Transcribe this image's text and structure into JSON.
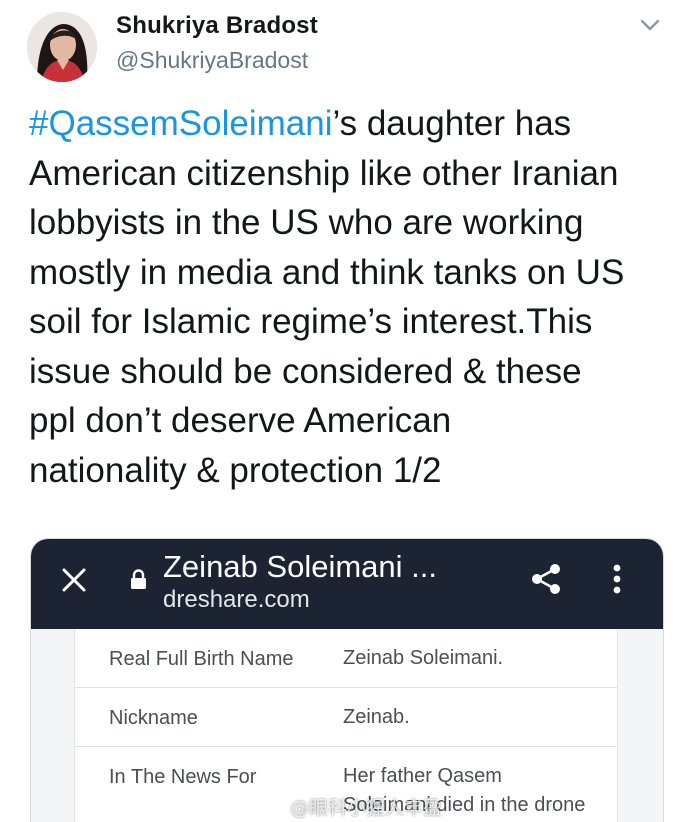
{
  "user": {
    "display_name": "Shukriya Bradost",
    "handle": "@ShukriyaBradost"
  },
  "tweet": {
    "hashtag": "#QassemSoleimani",
    "line1_rest": "’s daughter has",
    "lines": [
      "American citizenship like other Iranian",
      "lobbyists in the US who are working",
      "mostly in media and think tanks on US",
      "soil for Islamic regime’s interest.This",
      "issue should be considered & these",
      "ppl don’t deserve American",
      "nationality & protection 1/2"
    ]
  },
  "media": {
    "browser": {
      "page_title": "Zeinab Soleimani ...",
      "domain": "dreshare.com"
    },
    "table": {
      "rows": [
        {
          "label": "Real Full Birth Name",
          "value": "Zeinab Soleimani."
        },
        {
          "label": "Nickname",
          "value": "Zeinab."
        },
        {
          "label": "In The News For",
          "value": "Her father Qasem",
          "value2": "Soleimani died in the drone"
        }
      ]
    }
  },
  "watermark": "@眼科小猩人丰盈",
  "colors": {
    "hashtag": "#1b95e0",
    "text": "#14171a",
    "secondary": "#657786",
    "browser_bar": "#1c2433"
  },
  "icons": {
    "caret": "chevron-down-icon",
    "close": "close-icon",
    "lock": "lock-icon",
    "share": "share-icon",
    "more": "kebab-menu-icon"
  }
}
